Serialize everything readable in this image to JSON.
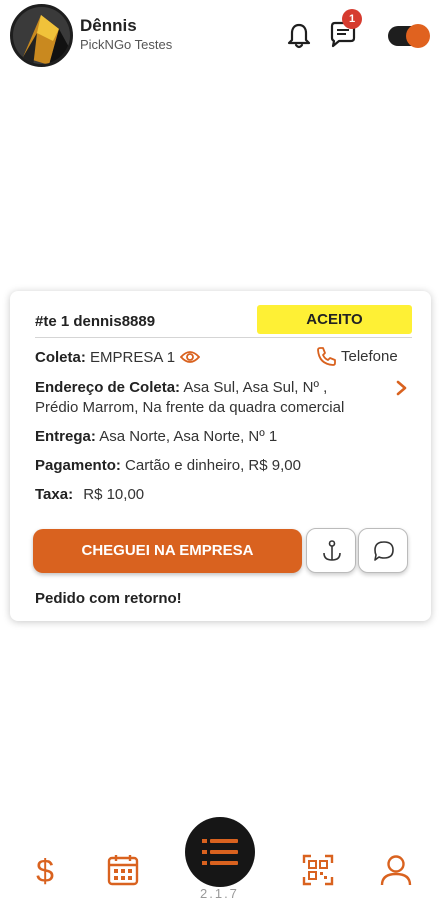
{
  "header": {
    "user_name": "Dênnis",
    "user_sub": "PickNGo Testes",
    "chat_badge": "1"
  },
  "order": {
    "id": "#te 1 dennis8889",
    "status": "ACEITO",
    "coleta_label": "Coleta:",
    "coleta_value": "EMPRESA 1",
    "phone_label": "Telefone",
    "endereco_label": "Endereço de Coleta:",
    "endereco_line1": "Asa Sul, Asa Sul, Nº ,",
    "endereco_line2": "Prédio Marrom, Na frente da quadra comercial",
    "entrega_label": "Entrega:",
    "entrega_value": "Asa Norte, Asa Norte, Nº 1",
    "pagamento_label": "Pagamento:",
    "pagamento_value": "Cartão e dinheiro, R$ 9,00",
    "taxa_label": "Taxa:",
    "taxa_value": "R$ 10,00",
    "action_button": "CHEGUEI NA EMPRESA",
    "note": "Pedido com retorno!"
  },
  "footer": {
    "version": "2.1.7"
  },
  "colors": {
    "accent": "#d9621f",
    "status_bg": "#fef035",
    "badge": "#d63b2f",
    "dark": "#161616"
  },
  "icons": [
    "bell-icon",
    "chat-icon",
    "toggle",
    "eye-icon",
    "phone-icon",
    "chevron-right-icon",
    "anchor-icon",
    "chat-bubble-icon",
    "dollar-icon",
    "calendar-icon",
    "list-icon",
    "qr-code-icon",
    "user-icon"
  ]
}
